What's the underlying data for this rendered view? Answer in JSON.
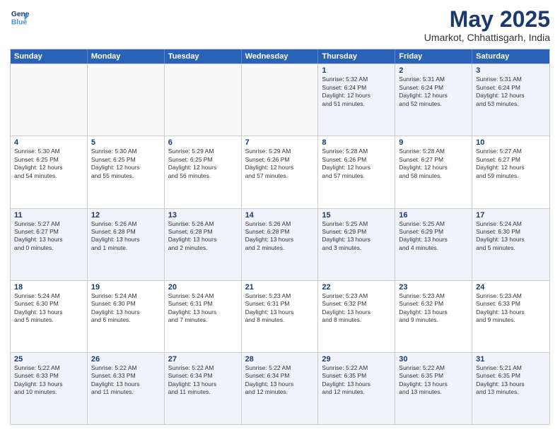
{
  "header": {
    "logo_line1": "General",
    "logo_line2": "Blue",
    "month_year": "May 2025",
    "location": "Umarkot, Chhattisgarh, India"
  },
  "days_of_week": [
    "Sunday",
    "Monday",
    "Tuesday",
    "Wednesday",
    "Thursday",
    "Friday",
    "Saturday"
  ],
  "rows": [
    [
      {
        "day": "",
        "info": ""
      },
      {
        "day": "",
        "info": ""
      },
      {
        "day": "",
        "info": ""
      },
      {
        "day": "",
        "info": ""
      },
      {
        "day": "1",
        "info": "Sunrise: 5:32 AM\nSunset: 6:24 PM\nDaylight: 12 hours\nand 51 minutes."
      },
      {
        "day": "2",
        "info": "Sunrise: 5:31 AM\nSunset: 6:24 PM\nDaylight: 12 hours\nand 52 minutes."
      },
      {
        "day": "3",
        "info": "Sunrise: 5:31 AM\nSunset: 6:24 PM\nDaylight: 12 hours\nand 53 minutes."
      }
    ],
    [
      {
        "day": "4",
        "info": "Sunrise: 5:30 AM\nSunset: 6:25 PM\nDaylight: 12 hours\nand 54 minutes."
      },
      {
        "day": "5",
        "info": "Sunrise: 5:30 AM\nSunset: 6:25 PM\nDaylight: 12 hours\nand 55 minutes."
      },
      {
        "day": "6",
        "info": "Sunrise: 5:29 AM\nSunset: 6:25 PM\nDaylight: 12 hours\nand 56 minutes."
      },
      {
        "day": "7",
        "info": "Sunrise: 5:29 AM\nSunset: 6:26 PM\nDaylight: 12 hours\nand 57 minutes."
      },
      {
        "day": "8",
        "info": "Sunrise: 5:28 AM\nSunset: 6:26 PM\nDaylight: 12 hours\nand 57 minutes."
      },
      {
        "day": "9",
        "info": "Sunrise: 5:28 AM\nSunset: 6:27 PM\nDaylight: 12 hours\nand 58 minutes."
      },
      {
        "day": "10",
        "info": "Sunrise: 5:27 AM\nSunset: 6:27 PM\nDaylight: 12 hours\nand 59 minutes."
      }
    ],
    [
      {
        "day": "11",
        "info": "Sunrise: 5:27 AM\nSunset: 6:27 PM\nDaylight: 13 hours\nand 0 minutes."
      },
      {
        "day": "12",
        "info": "Sunrise: 5:26 AM\nSunset: 6:28 PM\nDaylight: 13 hours\nand 1 minute."
      },
      {
        "day": "13",
        "info": "Sunrise: 5:26 AM\nSunset: 6:28 PM\nDaylight: 13 hours\nand 2 minutes."
      },
      {
        "day": "14",
        "info": "Sunrise: 5:26 AM\nSunset: 6:28 PM\nDaylight: 13 hours\nand 2 minutes."
      },
      {
        "day": "15",
        "info": "Sunrise: 5:25 AM\nSunset: 6:29 PM\nDaylight: 13 hours\nand 3 minutes."
      },
      {
        "day": "16",
        "info": "Sunrise: 5:25 AM\nSunset: 6:29 PM\nDaylight: 13 hours\nand 4 minutes."
      },
      {
        "day": "17",
        "info": "Sunrise: 5:24 AM\nSunset: 6:30 PM\nDaylight: 13 hours\nand 5 minutes."
      }
    ],
    [
      {
        "day": "18",
        "info": "Sunrise: 5:24 AM\nSunset: 6:30 PM\nDaylight: 13 hours\nand 5 minutes."
      },
      {
        "day": "19",
        "info": "Sunrise: 5:24 AM\nSunset: 6:30 PM\nDaylight: 13 hours\nand 6 minutes."
      },
      {
        "day": "20",
        "info": "Sunrise: 5:24 AM\nSunset: 6:31 PM\nDaylight: 13 hours\nand 7 minutes."
      },
      {
        "day": "21",
        "info": "Sunrise: 5:23 AM\nSunset: 6:31 PM\nDaylight: 13 hours\nand 8 minutes."
      },
      {
        "day": "22",
        "info": "Sunrise: 5:23 AM\nSunset: 6:32 PM\nDaylight: 13 hours\nand 8 minutes."
      },
      {
        "day": "23",
        "info": "Sunrise: 5:23 AM\nSunset: 6:32 PM\nDaylight: 13 hours\nand 9 minutes."
      },
      {
        "day": "24",
        "info": "Sunrise: 5:23 AM\nSunset: 6:33 PM\nDaylight: 13 hours\nand 9 minutes."
      }
    ],
    [
      {
        "day": "25",
        "info": "Sunrise: 5:22 AM\nSunset: 6:33 PM\nDaylight: 13 hours\nand 10 minutes."
      },
      {
        "day": "26",
        "info": "Sunrise: 5:22 AM\nSunset: 6:33 PM\nDaylight: 13 hours\nand 11 minutes."
      },
      {
        "day": "27",
        "info": "Sunrise: 5:22 AM\nSunset: 6:34 PM\nDaylight: 13 hours\nand 11 minutes."
      },
      {
        "day": "28",
        "info": "Sunrise: 5:22 AM\nSunset: 6:34 PM\nDaylight: 13 hours\nand 12 minutes."
      },
      {
        "day": "29",
        "info": "Sunrise: 5:22 AM\nSunset: 6:35 PM\nDaylight: 13 hours\nand 12 minutes."
      },
      {
        "day": "30",
        "info": "Sunrise: 5:22 AM\nSunset: 6:35 PM\nDaylight: 13 hours\nand 13 minutes."
      },
      {
        "day": "31",
        "info": "Sunrise: 5:21 AM\nSunset: 6:35 PM\nDaylight: 13 hours\nand 13 minutes."
      }
    ]
  ],
  "alt_rows": [
    0,
    2,
    4
  ]
}
